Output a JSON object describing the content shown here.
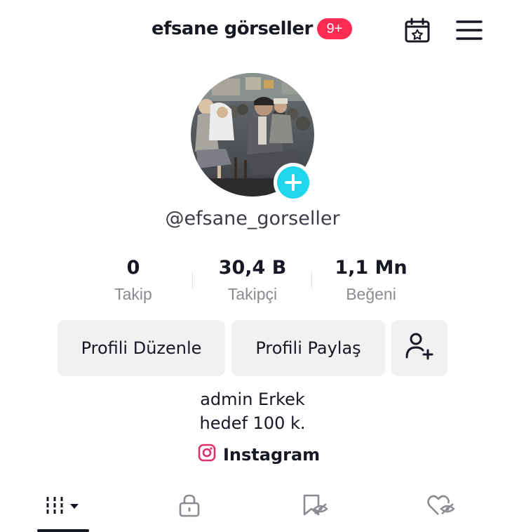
{
  "header": {
    "title": "efsane görseller",
    "notification_badge": "9+",
    "calendar_icon": "calendar-star-icon",
    "menu_icon": "hamburger-menu-icon"
  },
  "profile": {
    "username": "@efsane_gorseller",
    "avatar_icon": "add-plus-icon"
  },
  "stats": [
    {
      "value": "0",
      "label": "Takip"
    },
    {
      "value": "30,4 B",
      "label": "Takipçi"
    },
    {
      "value": "1,1 Mn",
      "label": "Beğeni"
    }
  ],
  "actions": {
    "edit_profile": "Profili Düzenle",
    "share_profile": "Profili Paylaş",
    "add_friend_icon": "add-user-icon"
  },
  "bio": {
    "line1": "admin Erkek",
    "line2": "hedef 100 k."
  },
  "link": {
    "label": "Instagram",
    "icon": "instagram-icon"
  },
  "tabs": [
    {
      "icon": "grid-videos-icon",
      "active": true
    },
    {
      "icon": "lock-icon",
      "active": false
    },
    {
      "icon": "bookmark-hidden-icon",
      "active": false
    },
    {
      "icon": "heart-hidden-icon",
      "active": false
    }
  ],
  "colors": {
    "accent": "#fe2c55",
    "plus_button": "#20d5ec",
    "button_bg": "#f1f1f2",
    "text_primary": "#161823",
    "text_secondary": "#8a8b91"
  }
}
